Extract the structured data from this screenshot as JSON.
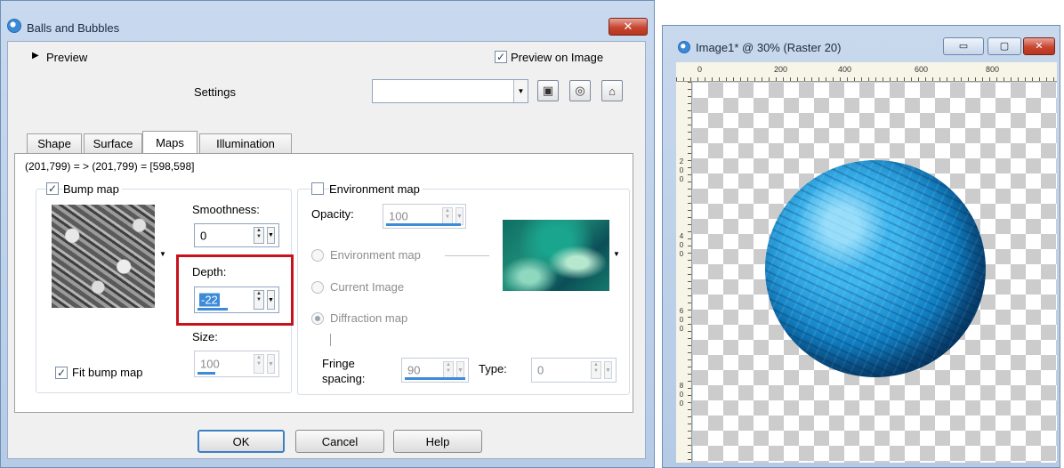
{
  "dialog": {
    "title": "Balls and Bubbles",
    "close_label": "✕",
    "preview_label": "Preview",
    "preview_on_image_label": "Preview on Image",
    "preview_on_image_checked": true,
    "settings_label": "Settings",
    "settings_value": "",
    "tabs": [
      {
        "label": "Shape",
        "active": false
      },
      {
        "label": "Surface",
        "active": false
      },
      {
        "label": "Maps",
        "active": true
      },
      {
        "label": "Illumination",
        "active": false
      }
    ],
    "coords_readout": "(201,799) = > (201,799) = [598,598]",
    "bump_map": {
      "label": "Bump map",
      "checked": true,
      "smoothness_label": "Smoothness:",
      "smoothness_value": "0",
      "depth_label": "Depth:",
      "depth_value": "-22",
      "size_label": "Size:",
      "size_value": "100",
      "fit_label": "Fit bump map",
      "fit_checked": true
    },
    "environment_map": {
      "label": "Environment map",
      "checked": false,
      "opacity_label": "Opacity:",
      "opacity_value": "100",
      "radio_environment_label": "Environment map",
      "radio_current_label": "Current Image",
      "radio_diffraction_label": "Diffraction map",
      "fringe_label_1": "Fringe",
      "fringe_label_2": "spacing:",
      "fringe_value": "90",
      "type_label": "Type:",
      "type_value": "0"
    },
    "buttons": {
      "ok": "OK",
      "cancel": "Cancel",
      "help": "Help"
    }
  },
  "image_window": {
    "title": "Image1* @ 30% (Raster 20)",
    "minimize_label": "▭",
    "maximize_label": "▢",
    "close_label": "✕",
    "ruler_top_labels": [
      "0",
      "200",
      "400",
      "600",
      "800"
    ],
    "ruler_left_labels": [
      "2",
      "0",
      "0",
      "4",
      "0",
      "0",
      "6",
      "0",
      "0",
      "8",
      "0",
      "0"
    ]
  },
  "colors": {
    "highlight": "#c8121b",
    "accent": "#3b8bd8",
    "ball": "#1180c4"
  }
}
